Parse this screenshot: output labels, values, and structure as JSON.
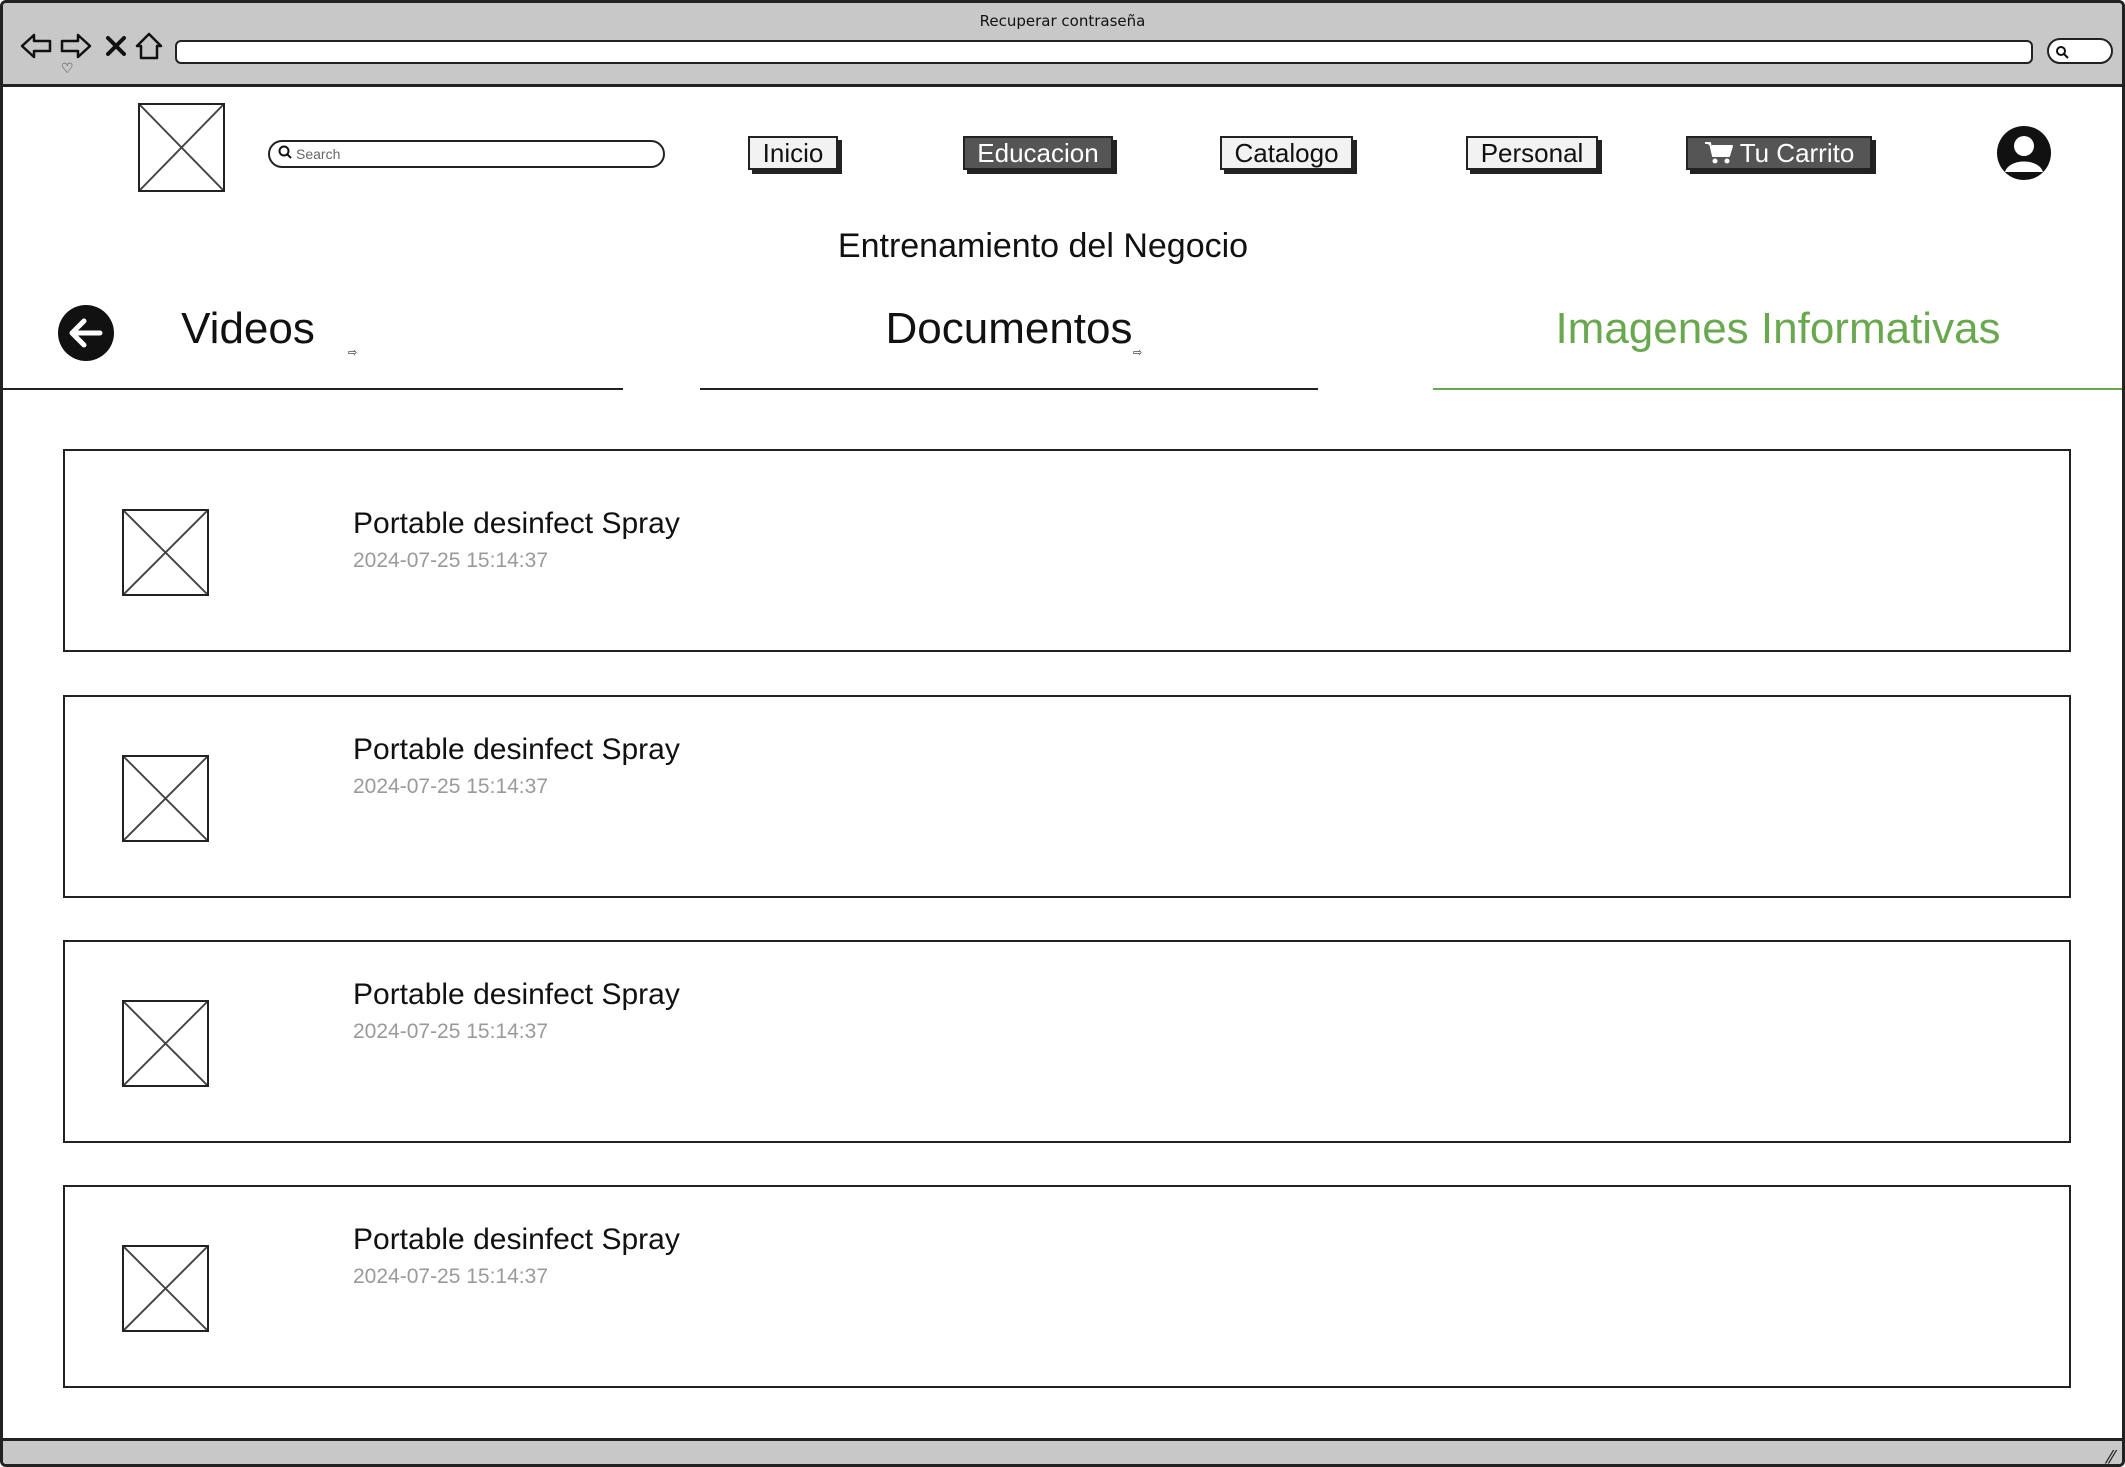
{
  "window": {
    "title": "Recuperar contraseña"
  },
  "header": {
    "search_placeholder": "Search",
    "nav": {
      "inicio": "Inicio",
      "educacion": "Educacion",
      "catalogo": "Catalogo",
      "personal": "Personal",
      "carrito": "Tu Carrito"
    }
  },
  "page": {
    "title": "Entrenamiento del Negocio"
  },
  "tabs": {
    "videos": "Videos",
    "documentos": "Documentos",
    "imagenes": "Imagenes Informativas",
    "active": "imagenes"
  },
  "items": [
    {
      "name": "Portable desinfect Spray",
      "date": "2024-07-25 15:14:37"
    },
    {
      "name": "Portable desinfect Spray",
      "date": "2024-07-25 15:14:37"
    },
    {
      "name": "Portable desinfect Spray",
      "date": "2024-07-25 15:14:37"
    },
    {
      "name": "Portable desinfect Spray",
      "date": "2024-07-25 15:14:37"
    }
  ],
  "colors": {
    "accent": "#6aa84f",
    "chrome": "#c8c8c8",
    "dark_button": "#555555",
    "muted_text": "#9a9a9a"
  },
  "icons": [
    "back-arrow-icon",
    "forward-arrow-icon",
    "close-icon",
    "home-icon",
    "search-icon",
    "cart-icon",
    "user-avatar-icon",
    "back-circle-icon",
    "image-placeholder-icon"
  ]
}
